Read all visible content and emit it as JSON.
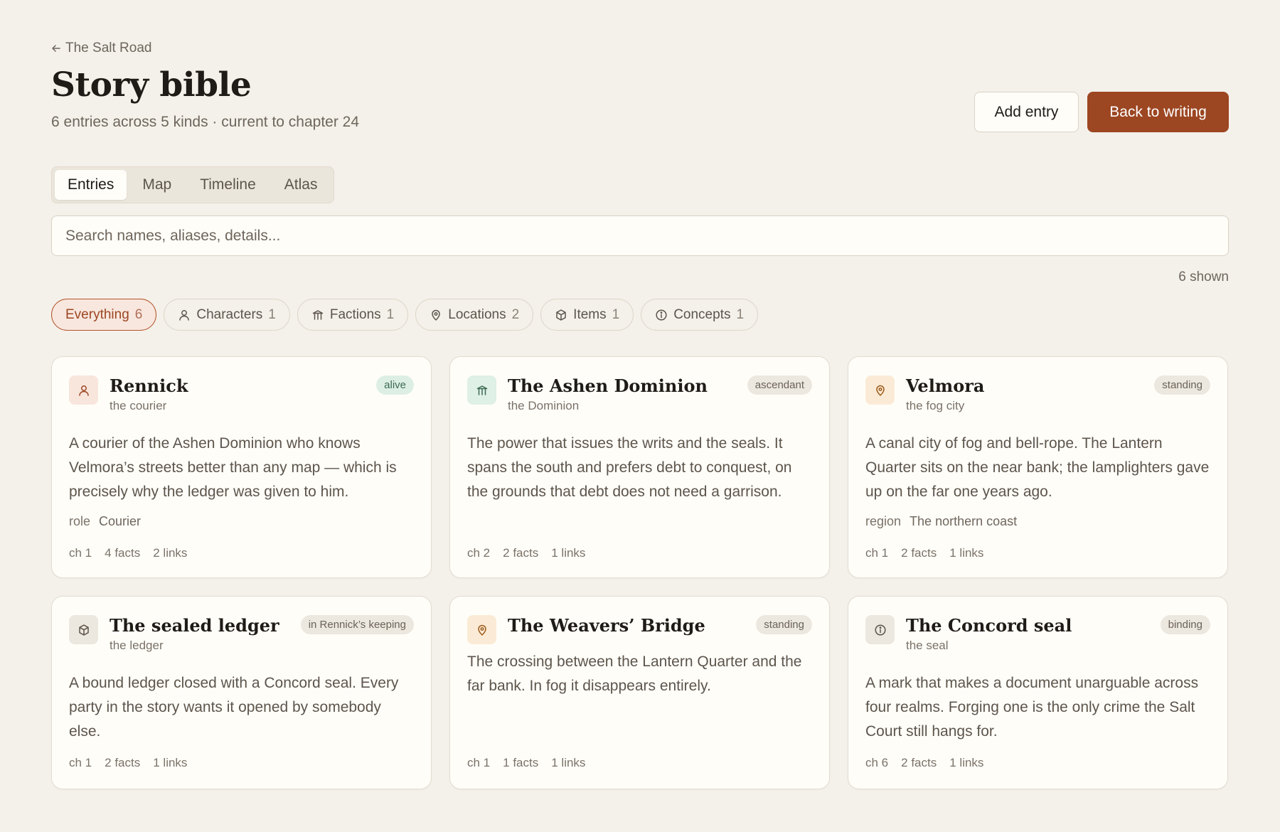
{
  "header": {
    "back_label": "The Salt Road",
    "title": "Story bible",
    "subtitle": "6 entries across 5 kinds · current to chapter 24",
    "add_entry_label": "Add entry",
    "back_to_writing_label": "Back to writing"
  },
  "tabs": [
    {
      "label": "Entries",
      "active": true
    },
    {
      "label": "Map"
    },
    {
      "label": "Timeline"
    },
    {
      "label": "Atlas"
    }
  ],
  "search": {
    "placeholder": "Search names, aliases, details..."
  },
  "shown_count": "6 shown",
  "filters": [
    {
      "label": "Everything",
      "count": "6",
      "icon": "",
      "active": true
    },
    {
      "label": "Characters",
      "count": "1",
      "icon": "person-icon"
    },
    {
      "label": "Factions",
      "count": "1",
      "icon": "building-icon"
    },
    {
      "label": "Locations",
      "count": "2",
      "icon": "map-pin-icon"
    },
    {
      "label": "Items",
      "count": "1",
      "icon": "cube-icon"
    },
    {
      "label": "Concepts",
      "count": "1",
      "icon": "info-icon"
    }
  ],
  "entries": [
    {
      "name": "Rennick",
      "alias": "the courier",
      "kind": "character",
      "icon": "person-icon",
      "status": "alive",
      "description": "A courier of the Ashen Dominion who knows Velmora’s streets better than any map — which is precisely why the ledger was given to him.",
      "fact_key": "role",
      "fact_value": "Courier",
      "chapter": "ch 1",
      "facts": "4 facts",
      "links": "2 links"
    },
    {
      "name": "The Ashen Dominion",
      "alias": "the Dominion",
      "kind": "faction",
      "icon": "building-icon",
      "status": "ascendant",
      "description": "The power that issues the writs and the seals. It spans the south and prefers debt to conquest, on the grounds that debt does not need a garrison.",
      "fact_key": "",
      "fact_value": "",
      "chapter": "ch 2",
      "facts": "2 facts",
      "links": "1 links"
    },
    {
      "name": "Velmora",
      "alias": "the fog city",
      "kind": "location",
      "icon": "map-pin-icon",
      "status": "standing",
      "description": "A canal city of fog and bell-rope. The Lantern Quarter sits on the near bank; the lamplighters gave up on the far one years ago.",
      "fact_key": "region",
      "fact_value": "The northern coast",
      "chapter": "ch 1",
      "facts": "2 facts",
      "links": "1 links"
    },
    {
      "name": "The sealed ledger",
      "alias": "the ledger",
      "kind": "item",
      "icon": "cube-icon",
      "status": "in Rennick’s keeping",
      "description": "A bound ledger closed with a Concord seal. Every party in the story wants it opened by somebody else.",
      "fact_key": "",
      "fact_value": "",
      "chapter": "ch 1",
      "facts": "2 facts",
      "links": "1 links"
    },
    {
      "name": "The Weavers’ Bridge",
      "alias": "",
      "kind": "location",
      "icon": "map-pin-icon",
      "status": "standing",
      "description": "The crossing between the Lantern Quarter and the far bank. In fog it disappears entirely.",
      "fact_key": "",
      "fact_value": "",
      "chapter": "ch 1",
      "facts": "1 facts",
      "links": "1 links"
    },
    {
      "name": "The Concord seal",
      "alias": "the seal",
      "kind": "concept",
      "icon": "info-icon",
      "status": "binding",
      "description": "A mark that makes a document unarguable across four realms. Forging one is the only crime the Salt Court still hangs for.",
      "fact_key": "",
      "fact_value": "",
      "chapter": "ch 6",
      "facts": "2 facts",
      "links": "1 links"
    }
  ],
  "colors": {
    "background": "#f4f1ea",
    "accent": "#9c4622",
    "card": "#fffdf8",
    "alive_badge": "#ddefe4"
  }
}
